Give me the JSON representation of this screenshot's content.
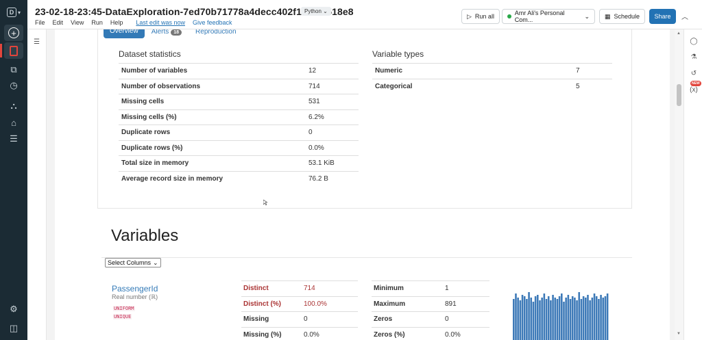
{
  "header": {
    "title": "23-02-18-23:45-DataExploration-7ed70b71778a4decc402f1264f7518e8",
    "language": "Python",
    "menu": [
      "File",
      "Edit",
      "View",
      "Run",
      "Help"
    ],
    "last_edit": "Last edit was now",
    "feedback": "Give feedback",
    "run_all": "Run all",
    "cluster": "Amr Ali's Personal Com...",
    "schedule": "Schedule",
    "share": "Share"
  },
  "report": {
    "tabs": [
      "Overview",
      "Alerts",
      "Reproduction"
    ],
    "alerts_count": "18",
    "dataset_statistics": {
      "heading": "Dataset statistics",
      "rows": [
        {
          "label": "Number of variables",
          "value": "12"
        },
        {
          "label": "Number of observations",
          "value": "714"
        },
        {
          "label": "Missing cells",
          "value": "531"
        },
        {
          "label": "Missing cells (%)",
          "value": "6.2%"
        },
        {
          "label": "Duplicate rows",
          "value": "0"
        },
        {
          "label": "Duplicate rows (%)",
          "value": "0.0%"
        },
        {
          "label": "Total size in memory",
          "value": "53.1 KiB"
        },
        {
          "label": "Average record size in memory",
          "value": "76.2 B"
        }
      ]
    },
    "variable_types": {
      "heading": "Variable types",
      "rows": [
        {
          "label": "Numeric",
          "value": "7"
        },
        {
          "label": "Categorical",
          "value": "5"
        }
      ]
    }
  },
  "variables": {
    "title": "Variables",
    "select_label": "Select Columns",
    "items": [
      {
        "name": "PassengerId",
        "type": "Real number (ℝ)",
        "tags": [
          "UNIFORM",
          "UNIQUE"
        ],
        "stats_left": [
          {
            "label": "Distinct",
            "value": "714"
          },
          {
            "label": "Distinct (%)",
            "value": "100.0%"
          },
          {
            "label": "Missing",
            "value": "0"
          },
          {
            "label": "Missing (%)",
            "value": "0.0%"
          }
        ],
        "stats_right": [
          {
            "label": "Minimum",
            "value": "1"
          },
          {
            "label": "Maximum",
            "value": "891"
          },
          {
            "label": "Zeros",
            "value": "0"
          },
          {
            "label": "Zeros (%)",
            "value": "0.0%"
          }
        ]
      }
    ]
  },
  "colors": {
    "accent": "#2272b4",
    "tab_active": "#337ab7",
    "histogram": "#3e7ab8",
    "highlight_red": "#a33"
  }
}
